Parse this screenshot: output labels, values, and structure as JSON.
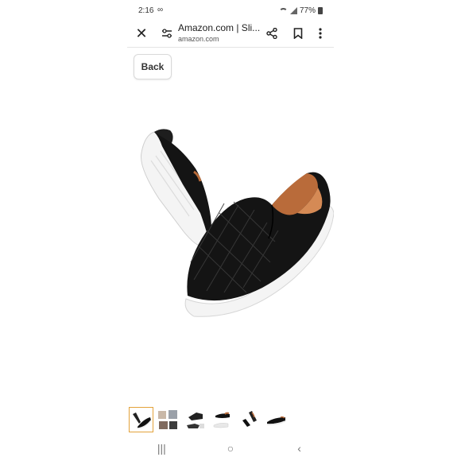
{
  "status_bar": {
    "time": "2:16",
    "link_glyph": "∞",
    "battery": "77%"
  },
  "toolbar": {
    "title": "Amazon.com | Sli...",
    "domain": "amazon.com"
  },
  "back_label": "Back",
  "icons": {
    "close": "close-icon",
    "settings": "tune-icon",
    "share": "share-icon",
    "bookmark": "bookmark-icon",
    "more": "more-vertical-icon"
  },
  "thumbnails": {
    "count": 6,
    "selected_index": 0
  },
  "navbar": {
    "recents": "|||",
    "home": "○",
    "back": "‹"
  },
  "colors": {
    "shoe": "#141414",
    "sole": "#f4f4f4",
    "lining": "#b96b3a",
    "selected_thumb": "#e3a23b"
  }
}
